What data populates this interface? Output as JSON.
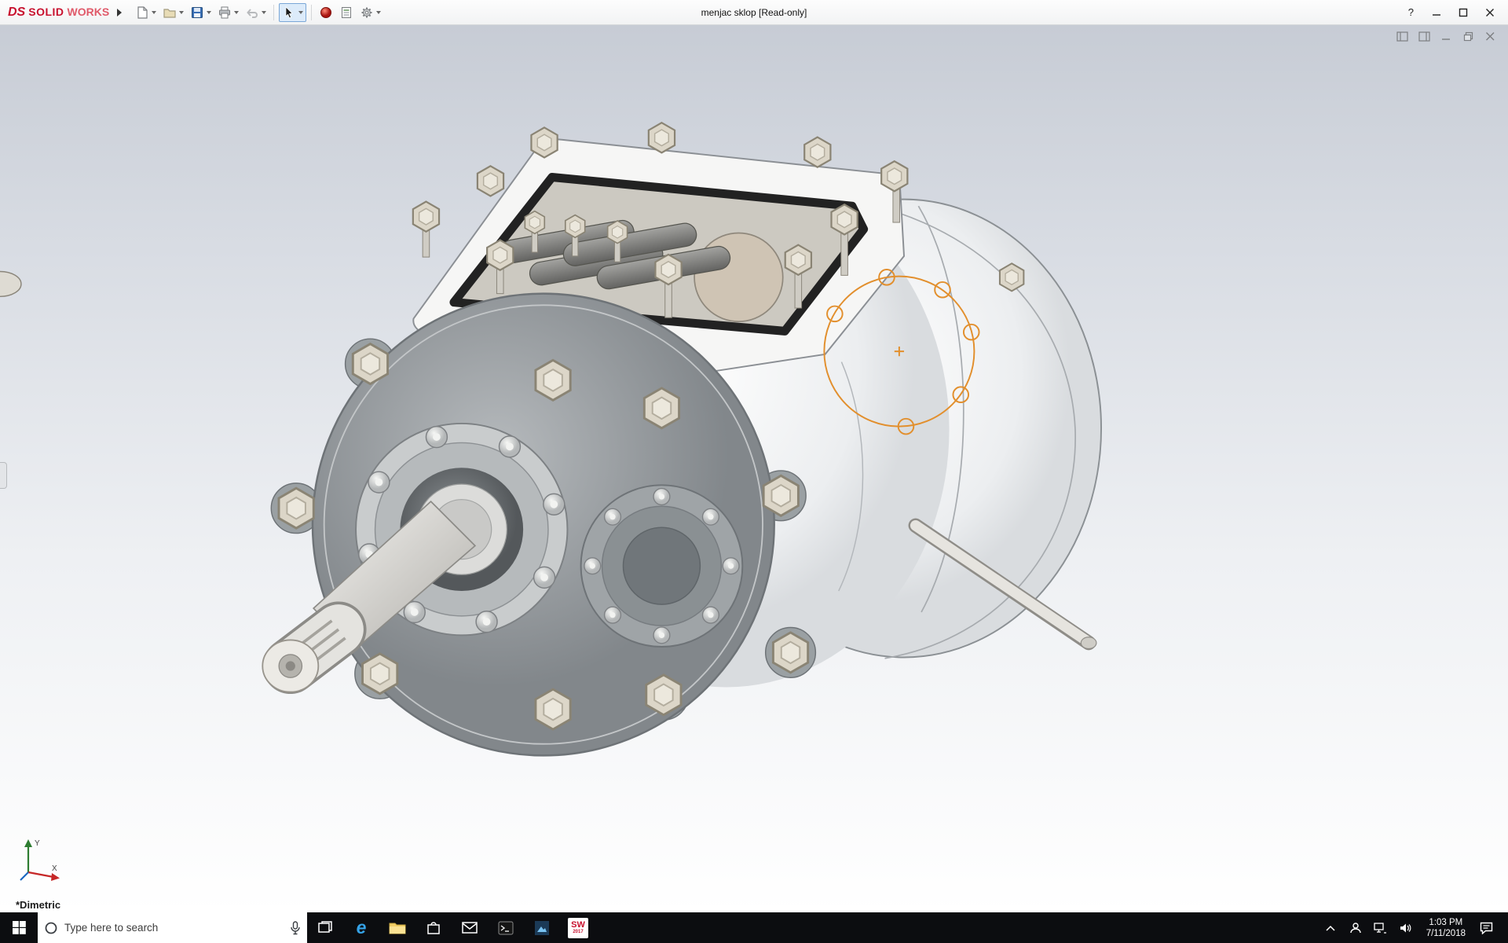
{
  "app": {
    "logo_prefix": "DS",
    "logo_text": "SOLID",
    "logo_text2": "WORKS",
    "title": "menjac sklop [Read-only]",
    "help": "?"
  },
  "toolbar": {
    "icon_names": [
      "new-document",
      "open-folder",
      "save",
      "print",
      "undo",
      "select-cursor",
      "appearance-sphere",
      "design-report",
      "options-gear"
    ]
  },
  "viewport": {
    "view_label": "*Dimetric",
    "triad": {
      "x": "X",
      "y": "Y"
    },
    "sketch_color": "#e28f2d",
    "model_name": "gearbox-assembly"
  },
  "taskbar": {
    "search_placeholder": "Type here to search",
    "edge_glyph": "e",
    "sw_badge": {
      "line1": "SW",
      "line2": "2017"
    },
    "icon_names": [
      "start",
      "search",
      "microphone",
      "task-view",
      "edge",
      "file-explorer",
      "store",
      "mail",
      "command-prompt",
      "photos",
      "solidworks-2017"
    ],
    "tray_icon_names": [
      "chevron-up",
      "people",
      "network",
      "volume",
      "clock",
      "action-center"
    ],
    "clock": {
      "time": "1:03 PM",
      "date": "7/11/2018"
    }
  }
}
